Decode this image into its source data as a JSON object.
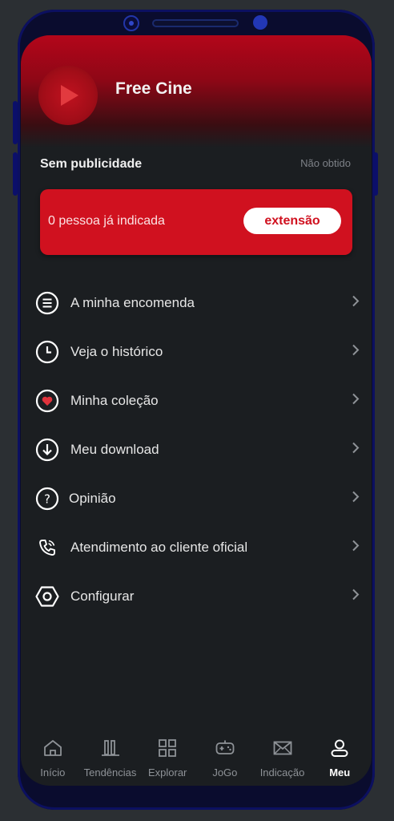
{
  "app": {
    "title": "Free Cine",
    "logo_icon": "play-icon"
  },
  "subscription": {
    "label": "Sem publicidade",
    "status": "Não obtido"
  },
  "referral": {
    "text": "0 pessoa já indicada",
    "button_label": "extensão"
  },
  "colors": {
    "accent": "#d0111f",
    "background": "#1b1e21",
    "text": "#e6e6e6",
    "muted": "#8e9297"
  },
  "menu": {
    "items": [
      {
        "label": "A minha encomenda",
        "icon": "list-icon"
      },
      {
        "label": "Veja o histórico",
        "icon": "clock-icon"
      },
      {
        "label": "Minha coleção",
        "icon": "heart-icon"
      },
      {
        "label": "Meu download",
        "icon": "download-icon"
      },
      {
        "label": "Opinião",
        "icon": "question-icon"
      },
      {
        "label": "Atendimento ao cliente oficial",
        "icon": "phone-icon"
      },
      {
        "label": "Configurar",
        "icon": "settings-icon"
      }
    ]
  },
  "nav": {
    "items": [
      {
        "label": "Início",
        "icon": "home-icon"
      },
      {
        "label": "Tendências",
        "icon": "trending-icon"
      },
      {
        "label": "Explorar",
        "icon": "grid-icon"
      },
      {
        "label": "JoGo",
        "icon": "gamepad-icon"
      },
      {
        "label": "Indicação",
        "icon": "mail-icon"
      },
      {
        "label": "Meu",
        "icon": "user-icon",
        "active": true
      }
    ]
  }
}
